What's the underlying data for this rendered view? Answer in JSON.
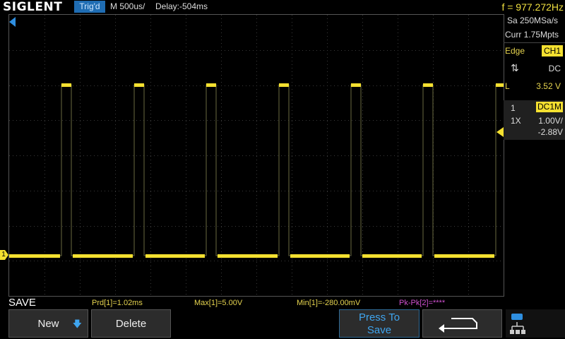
{
  "top_bar": {
    "brand": "SIGLENT",
    "trigger_status": "Trig'd",
    "timebase": "M 500us/",
    "delay": "Delay:-504ms",
    "frequency": "f = 977.272Hz"
  },
  "acquisition": {
    "sample_rate": "Sa 250MSa/s",
    "memory_depth": "Curr 1.75Mpts"
  },
  "trigger": {
    "type_label": "Edge",
    "source": "CH1",
    "slope_icon": "rising-falling-slope-icon",
    "coupling": "DC",
    "level_label": "L",
    "level": "3.52 V"
  },
  "channel1": {
    "number": "1",
    "coupling": "DC1M",
    "probe": "1X",
    "scale": "1.00V/",
    "offset": "-2.88V",
    "marker_label": "1",
    "color": "#f4e030"
  },
  "measurements": [
    {
      "label": "Prd[1]=1.02ms"
    },
    {
      "label": "Max[1]=5.00V"
    },
    {
      "label": "Min[1]=-280.00mV"
    },
    {
      "label": "Pk-Pk[2]=****"
    }
  ],
  "menu": {
    "title": "SAVE",
    "softkeys": {
      "new": "New",
      "delete": "Delete",
      "press_line1": "Press To",
      "press_line2": "Save",
      "back_icon": "return-arrow-icon",
      "network_icon": "network-status-icon"
    }
  },
  "waveform": {
    "high_volts": 5.0,
    "low_volts": -0.28,
    "period_ms": 1.02,
    "color": "#f4e030"
  }
}
